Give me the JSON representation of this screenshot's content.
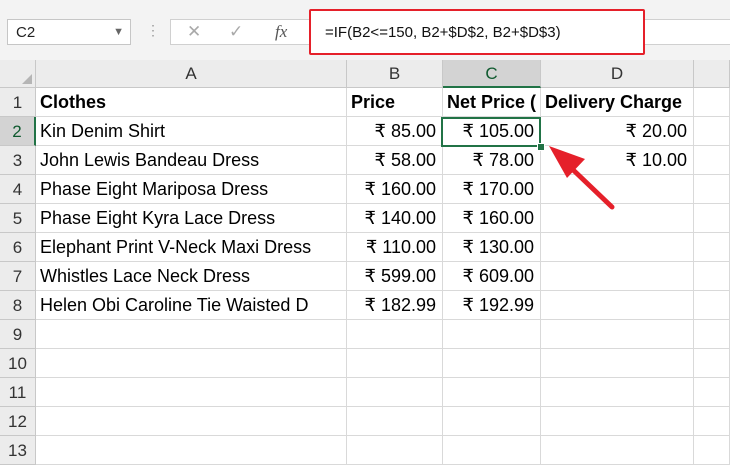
{
  "name_box": {
    "value": "C2",
    "dropdown_icon": "chevron-down-icon"
  },
  "formula_bar": {
    "cancel_icon": "close-icon",
    "enter_icon": "check-icon",
    "function_icon": "fx-icon",
    "fx_label": "fx",
    "formula": "=IF(B2<=150, B2+$D$2, B2+$D$3)"
  },
  "columns": [
    "A",
    "B",
    "C",
    "D"
  ],
  "rows": [
    "1",
    "2",
    "3",
    "4",
    "5",
    "6",
    "7",
    "8",
    "9",
    "10",
    "11",
    "12",
    "13"
  ],
  "header_row": {
    "a": "Clothes",
    "b": "Price",
    "c": "Net Price (",
    "d": "Delivery Charge"
  },
  "data_rows": [
    {
      "a": "Kin Denim Shirt",
      "b": "₹ 85.00",
      "c": "₹ 105.00",
      "d": "₹ 20.00"
    },
    {
      "a": "John Lewis Bandeau Dress",
      "b": "₹ 58.00",
      "c": "₹ 78.00",
      "d": "₹ 10.00"
    },
    {
      "a": "Phase Eight Mariposa Dress",
      "b": "₹ 160.00",
      "c": "₹ 170.00",
      "d": ""
    },
    {
      "a": "Phase Eight Kyra Lace Dress",
      "b": "₹ 140.00",
      "c": "₹ 160.00",
      "d": ""
    },
    {
      "a": "Elephant Print V-Neck Maxi Dress",
      "b": "₹ 110.00",
      "c": "₹ 130.00",
      "d": ""
    },
    {
      "a": "Whistles Lace Neck Dress",
      "b": "₹ 599.00",
      "c": "₹ 609.00",
      "d": ""
    },
    {
      "a": "Helen Obi Caroline Tie Waisted D",
      "b": "₹ 182.99",
      "c": "₹ 192.99",
      "d": ""
    }
  ],
  "active_cell": "C2",
  "colors": {
    "highlight": "#e5202a",
    "selection": "#217346",
    "annotation_arrow": "#e5202a"
  }
}
